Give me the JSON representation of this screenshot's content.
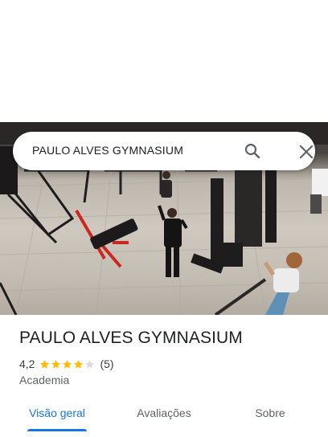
{
  "search": {
    "query": "PAULO ALVES GYMNASIUM"
  },
  "place": {
    "name": "PAULO ALVES GYMNASIUM",
    "rating": "4,2",
    "stars": 4.2,
    "review_count": "(5)",
    "category": "Academia"
  },
  "tabs": [
    {
      "label": "Visão geral",
      "active": true
    },
    {
      "label": "Avaliações",
      "active": false
    },
    {
      "label": "Sobre",
      "active": false
    }
  ],
  "colors": {
    "accent": "#1a73e8",
    "star": "#fbbc04",
    "star_empty": "#dadce0"
  },
  "icons": {
    "search": "search-icon",
    "close": "close-icon"
  }
}
